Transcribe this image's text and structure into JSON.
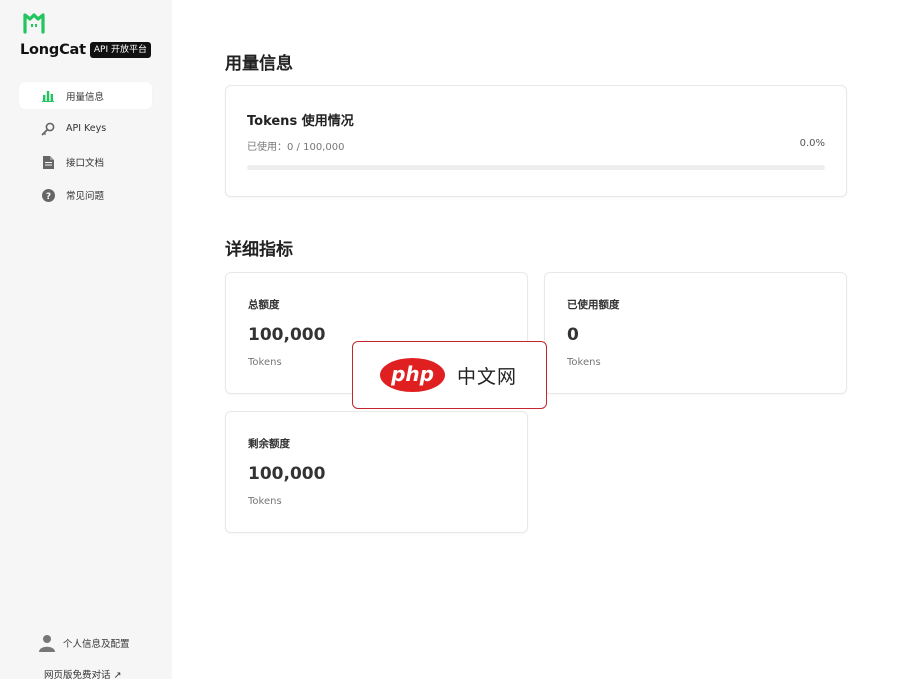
{
  "brand": {
    "name": "LongCat",
    "tag": "API 开放平台",
    "accent": "#22c55e"
  },
  "sidebar": {
    "items": [
      {
        "label": "用量信息",
        "icon": "bar-chart-icon",
        "active": true
      },
      {
        "label": "API Keys",
        "icon": "key-icon",
        "active": false
      },
      {
        "label": "接口文档",
        "icon": "document-icon",
        "active": false
      },
      {
        "label": "常见问题",
        "icon": "question-icon",
        "active": false
      }
    ],
    "profile_label": "个人信息及配置",
    "web_chat_label": "网页版免费对话 ↗"
  },
  "usage": {
    "section_title": "用量信息",
    "card_title": "Tokens 使用情况",
    "used_text": "已使用：0 / 100,000",
    "percent_text": "0.0%",
    "progress": 0.0
  },
  "metrics": {
    "section_title": "详细指标",
    "total": {
      "label": "总额度",
      "value": "100,000",
      "unit": "Tokens"
    },
    "used": {
      "label": "已使用额度",
      "value": "0",
      "unit": "Tokens"
    },
    "remaining": {
      "label": "剩余额度",
      "value": "100,000",
      "unit": "Tokens"
    }
  },
  "watermark": {
    "logo_text": "php",
    "site_text": "中文网"
  }
}
